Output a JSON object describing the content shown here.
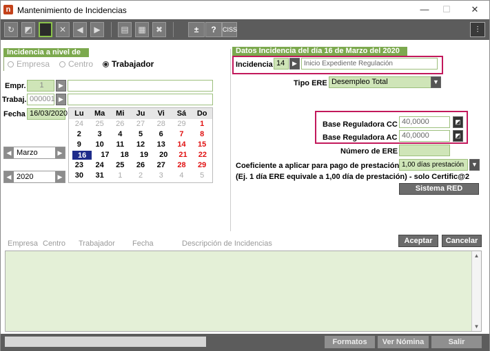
{
  "window": {
    "title": "Mantenimiento de Incidencias"
  },
  "controls": {
    "minimize": "—",
    "maximize": "☐",
    "close": "✕"
  },
  "toolbar": {
    "plus_minus": "±",
    "help": "?",
    "ciss": "CISS"
  },
  "left": {
    "section_title": "Incidencia a nivel de",
    "radios": [
      {
        "label": "Empresa",
        "selected": false
      },
      {
        "label": "Centro",
        "selected": false
      },
      {
        "label": "Trabajador",
        "selected": true
      }
    ],
    "empr_label": "Empr.",
    "empr_value": "1",
    "trabaj_label": "Trabaj.",
    "trabaj_value": "000001",
    "fecha_label": "Fecha",
    "fecha_value": "16/03/2020",
    "month": "Marzo",
    "year": "2020"
  },
  "calendar": {
    "weekdays": [
      "Lu",
      "Ma",
      "Mi",
      "Ju",
      "Vi",
      "Sá",
      "Do"
    ],
    "rows": [
      [
        "24",
        "25",
        "26",
        "27",
        "28",
        "29",
        "1"
      ],
      [
        "2",
        "3",
        "4",
        "5",
        "6",
        "7",
        "8"
      ],
      [
        "9",
        "10",
        "11",
        "12",
        "13",
        "14",
        "15"
      ],
      [
        "16",
        "17",
        "18",
        "19",
        "20",
        "21",
        "22"
      ],
      [
        "23",
        "24",
        "25",
        "26",
        "27",
        "28",
        "29"
      ],
      [
        "30",
        "31",
        "1",
        "2",
        "3",
        "4",
        "5"
      ]
    ]
  },
  "right": {
    "section_title": "Datos Incidencia del día 16 de Marzo del 2020",
    "incidencia_label": "Incidencia",
    "incidencia_code": "14",
    "incidencia_desc": "Inicio Expediente Regulación",
    "tipo_ere_label": "Tipo ERE",
    "tipo_ere_value": "Desempleo Total",
    "base_cc_label": "Base Reguladora CC",
    "base_cc_value": "40,0000",
    "base_ac_label": "Base Reguladora AC",
    "base_ac_value": "40,0000",
    "numero_ere_label": "Número de ERE",
    "coef_label": "Coeficiente a aplicar para pago de prestación",
    "coef_value": "1,00 días prestación",
    "note": "(Ej. 1 día ERE equivale a 1,00 día de prestación) - solo Certific@2",
    "sistema_red": "Sistema RED"
  },
  "list": {
    "columns": [
      "Empresa",
      "Centro",
      "Trabajador",
      "Fecha",
      "Descripción de Incidencias"
    ],
    "accept": "Aceptar",
    "cancel": "Cancelar"
  },
  "status": {
    "formatos": "Formatos",
    "ver_nomina": "Ver Nómina",
    "salir": "Salir"
  }
}
